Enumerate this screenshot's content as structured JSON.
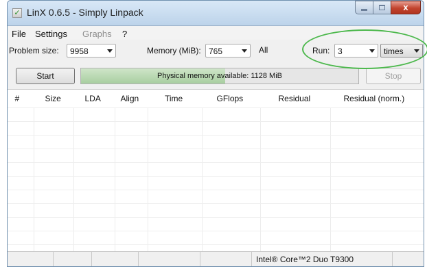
{
  "window": {
    "title": "LinX 0.6.5 - Simply Linpack",
    "close_glyph": "x"
  },
  "icons": {
    "app": "checkmark-icon",
    "dropdown": "chevron-down-icon"
  },
  "menu": {
    "file": "File",
    "settings": "Settings",
    "graphs": "Graphs",
    "help": "?"
  },
  "controls": {
    "problem_size_label": "Problem size:",
    "problem_size_value": "9958",
    "memory_label": "Memory (MiB):",
    "memory_value": "765",
    "all_label": "All",
    "run_label": "Run:",
    "run_value": "3",
    "run_unit": "times"
  },
  "buttons": {
    "start": "Start",
    "stop": "Stop"
  },
  "progress": {
    "text": "Physical memory available: 1128 MiB",
    "level": 0.52
  },
  "table": {
    "columns": [
      "#",
      "Size",
      "LDA",
      "Align",
      "Time",
      "GFlops",
      "Residual",
      "Residual (norm.)"
    ],
    "rows": []
  },
  "status": {
    "cpu": "Intel® Core™2 Duo T9300"
  },
  "colors": {
    "highlight": "#4cb84c",
    "close_button": "#c2442f"
  }
}
